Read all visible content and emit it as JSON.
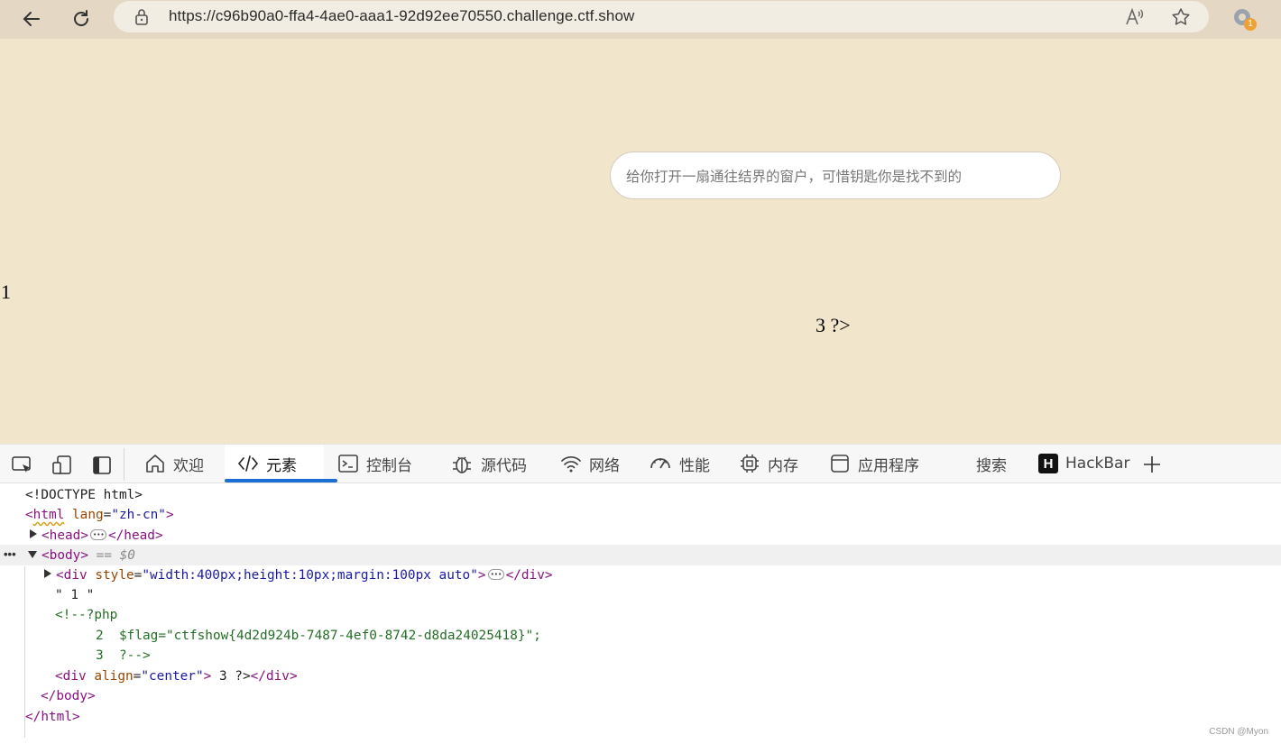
{
  "browser": {
    "url": "https://c96b90a0-ffa4-4ae0-aaa1-92d92ee70550.challenge.ctf.show",
    "extension_badge": "1"
  },
  "page": {
    "text_box": "给你打开一扇通往结界的窗户，可惜钥匙你是找不到的",
    "text_one": "1",
    "text_three": "3 ?>"
  },
  "devtools": {
    "tabs": [
      {
        "label": "欢迎",
        "icon": "home-icon"
      },
      {
        "label": "元素",
        "icon": "code-icon",
        "active": true
      },
      {
        "label": "控制台",
        "icon": "console-icon"
      },
      {
        "label": "源代码",
        "icon": "bug-icon"
      },
      {
        "label": "网络",
        "icon": "wifi-icon"
      },
      {
        "label": "性能",
        "icon": "gauge-icon"
      },
      {
        "label": "内存",
        "icon": "chip-icon"
      },
      {
        "label": "应用程序",
        "icon": "app-icon"
      },
      {
        "label": "搜索",
        "icon": ""
      },
      {
        "label": "HackBar",
        "icon": "hackbar-icon"
      }
    ]
  },
  "dom": {
    "doctype": "<!DOCTYPE html>",
    "html_open_tag": "html",
    "html_attr_name": "lang",
    "html_attr_val": "\"zh-cn\"",
    "head_open": "<head>",
    "head_close": "</head>",
    "body_open": "<body>",
    "body_marker": "== $0",
    "div_tag": "<div",
    "div_attr_name": "style",
    "div_attr_val": "\"width:400px;height:10px;margin:100px auto\"",
    "div_end": ">",
    "div_close": "</div>",
    "text_node": "\" 1 \"",
    "comment_open": "<!--?php",
    "comment_line2_num": "2",
    "comment_line2": "$flag=\"ctfshow{4d2d924b-7487-4ef0-8742-d8da24025418}\";",
    "comment_line3_num": "3",
    "comment_line3": "?-->",
    "div2_tag": "<div",
    "div2_attr_name": "align",
    "div2_attr_val": "\"center\"",
    "div2_gt": ">",
    "div2_text": " 3 ?>",
    "div2_close": "</div>",
    "body_close": "</body>",
    "html_close": "</html>"
  },
  "watermark": "CSDN @Myon⁠"
}
